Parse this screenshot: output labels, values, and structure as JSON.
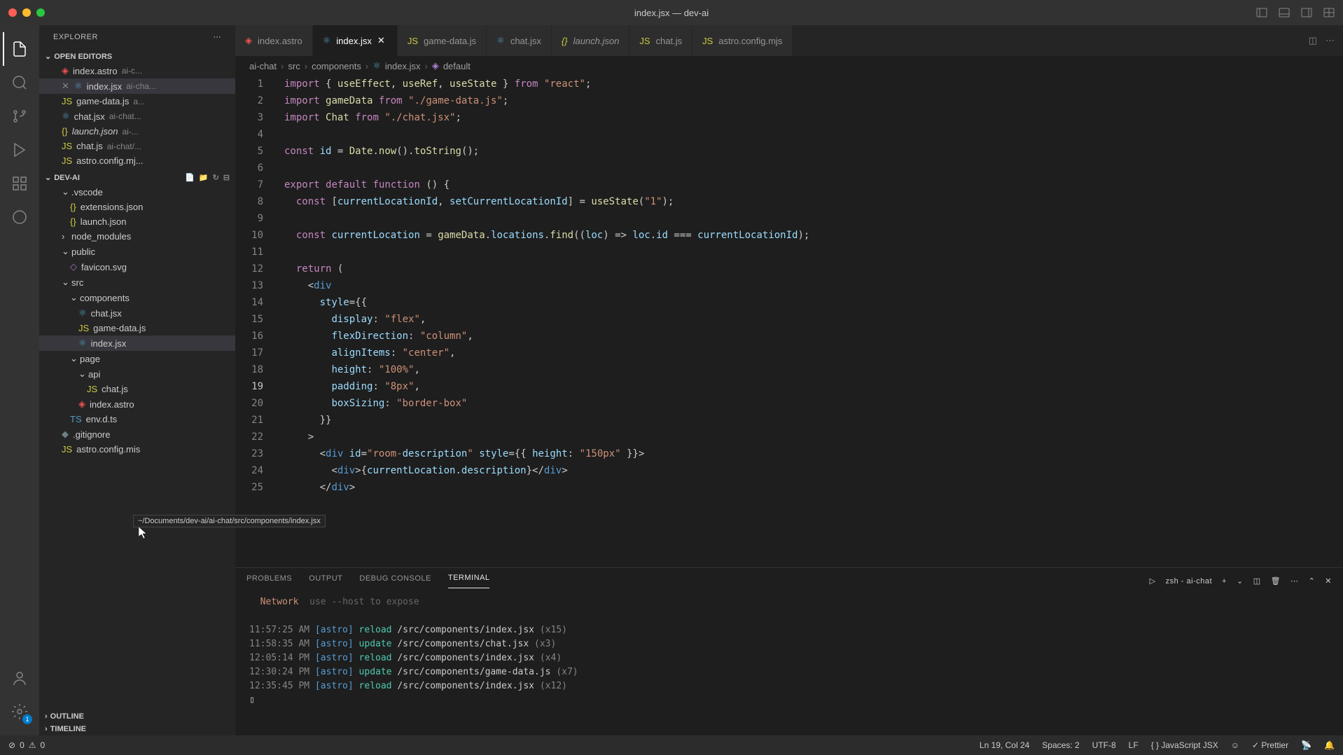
{
  "window": {
    "title": "index.jsx — dev-ai"
  },
  "explorer": {
    "title": "EXPLORER",
    "sections": {
      "openEditors": {
        "label": "OPEN EDITORS",
        "items": [
          {
            "name": "index.astro",
            "sub": "ai-c..."
          },
          {
            "name": "index.jsx",
            "sub": "ai-cha...",
            "active": true
          },
          {
            "name": "game-data.js",
            "sub": "a..."
          },
          {
            "name": "chat.jsx",
            "sub": "ai-chat..."
          },
          {
            "name": "launch.json",
            "sub": "ai-..."
          },
          {
            "name": "chat.js",
            "sub": "ai-chat/..."
          },
          {
            "name": "astro.config.mj...",
            "sub": ""
          }
        ]
      },
      "project": {
        "label": "DEV-AI",
        "tree": {
          "vscode": ".vscode",
          "extensions": "extensions.json",
          "launch": "launch.json",
          "node_modules": "node_modules",
          "public": "public",
          "favicon": "favicon.svg",
          "src": "src",
          "components": "components",
          "chatjsx": "chat.jsx",
          "gamedata": "game-data.js",
          "indexjsx": "index.jsx",
          "pages": "page",
          "api": "api",
          "chatjs": "chat.js",
          "indexastro": "index.astro",
          "envdts": "env.d.ts",
          "gitignore": ".gitignore",
          "astroconfig": "astro.config.mis"
        }
      },
      "outline": {
        "label": "OUTLINE"
      },
      "timeline": {
        "label": "TIMELINE"
      }
    }
  },
  "tabs": [
    {
      "name": "index.astro",
      "icon": "astro"
    },
    {
      "name": "index.jsx",
      "icon": "react",
      "active": true,
      "close": true
    },
    {
      "name": "game-data.js",
      "icon": "js"
    },
    {
      "name": "chat.jsx",
      "icon": "react"
    },
    {
      "name": "launch.json",
      "icon": "json",
      "italic": true
    },
    {
      "name": "chat.js",
      "icon": "js"
    },
    {
      "name": "astro.config.mjs",
      "icon": "js"
    }
  ],
  "breadcrumb": {
    "parts": [
      "ai-chat",
      "src",
      "components",
      "index.jsx",
      "default"
    ]
  },
  "code": {
    "lines": [
      "import { useEffect, useRef, useState } from \"react\";",
      "import gameData from \"./game-data.js\";",
      "import Chat from \"./chat.jsx\";",
      "",
      "const id = Date.now().toString();",
      "",
      "export default function () {",
      "  const [currentLocationId, setCurrentLocationId] = useState(\"1\");",
      "",
      "  const currentLocation = gameData.locations.find((loc) => loc.id === currentLocationId);",
      "",
      "  return (",
      "    <div",
      "      style={{",
      "        display: \"flex\",",
      "        flexDirection: \"column\",",
      "        alignItems: \"center\",",
      "        height: \"100%\",",
      "        padding: \"8px\",",
      "        boxSizing: \"border-box\"",
      "      }}",
      "    >",
      "      <div id=\"room-description\" style={{ height: \"150px\" }}>",
      "        <div>{currentLocation.description}</div>",
      "      </div>"
    ],
    "currentLine": 19
  },
  "panel": {
    "tabs": [
      "PROBLEMS",
      "OUTPUT",
      "DEBUG CONSOLE",
      "TERMINAL"
    ],
    "active": "TERMINAL",
    "shell": "zsh - ai-chat",
    "network": "Network",
    "hint": "use --host to expose",
    "log": [
      {
        "time": "11:57:25 AM",
        "src": "[astro]",
        "act": "reload",
        "path": "/src/components/index.jsx",
        "cnt": "(x15)"
      },
      {
        "time": "11:58:35 AM",
        "src": "[astro]",
        "act": "update",
        "path": "/src/components/chat.jsx",
        "cnt": "(x3)"
      },
      {
        "time": "12:05:14 PM",
        "src": "[astro]",
        "act": "reload",
        "path": "/src/components/index.jsx",
        "cnt": "(x4)"
      },
      {
        "time": "12:30:24 PM",
        "src": "[astro]",
        "act": "update",
        "path": "/src/components/game-data.js",
        "cnt": "(x7)"
      },
      {
        "time": "12:35:45 PM",
        "src": "[astro]",
        "act": "reload",
        "path": "/src/components/index.jsx",
        "cnt": "(x12)"
      }
    ]
  },
  "statusbar": {
    "errors": "0",
    "warnings": "0",
    "cursor": "Ln 19, Col 24",
    "spaces": "Spaces: 2",
    "encoding": "UTF-8",
    "eol": "LF",
    "lang": "JavaScript JSX",
    "prettier": "Prettier"
  },
  "tooltip": "~/Documents/dev-ai/ai-chat/src/components/index.jsx"
}
